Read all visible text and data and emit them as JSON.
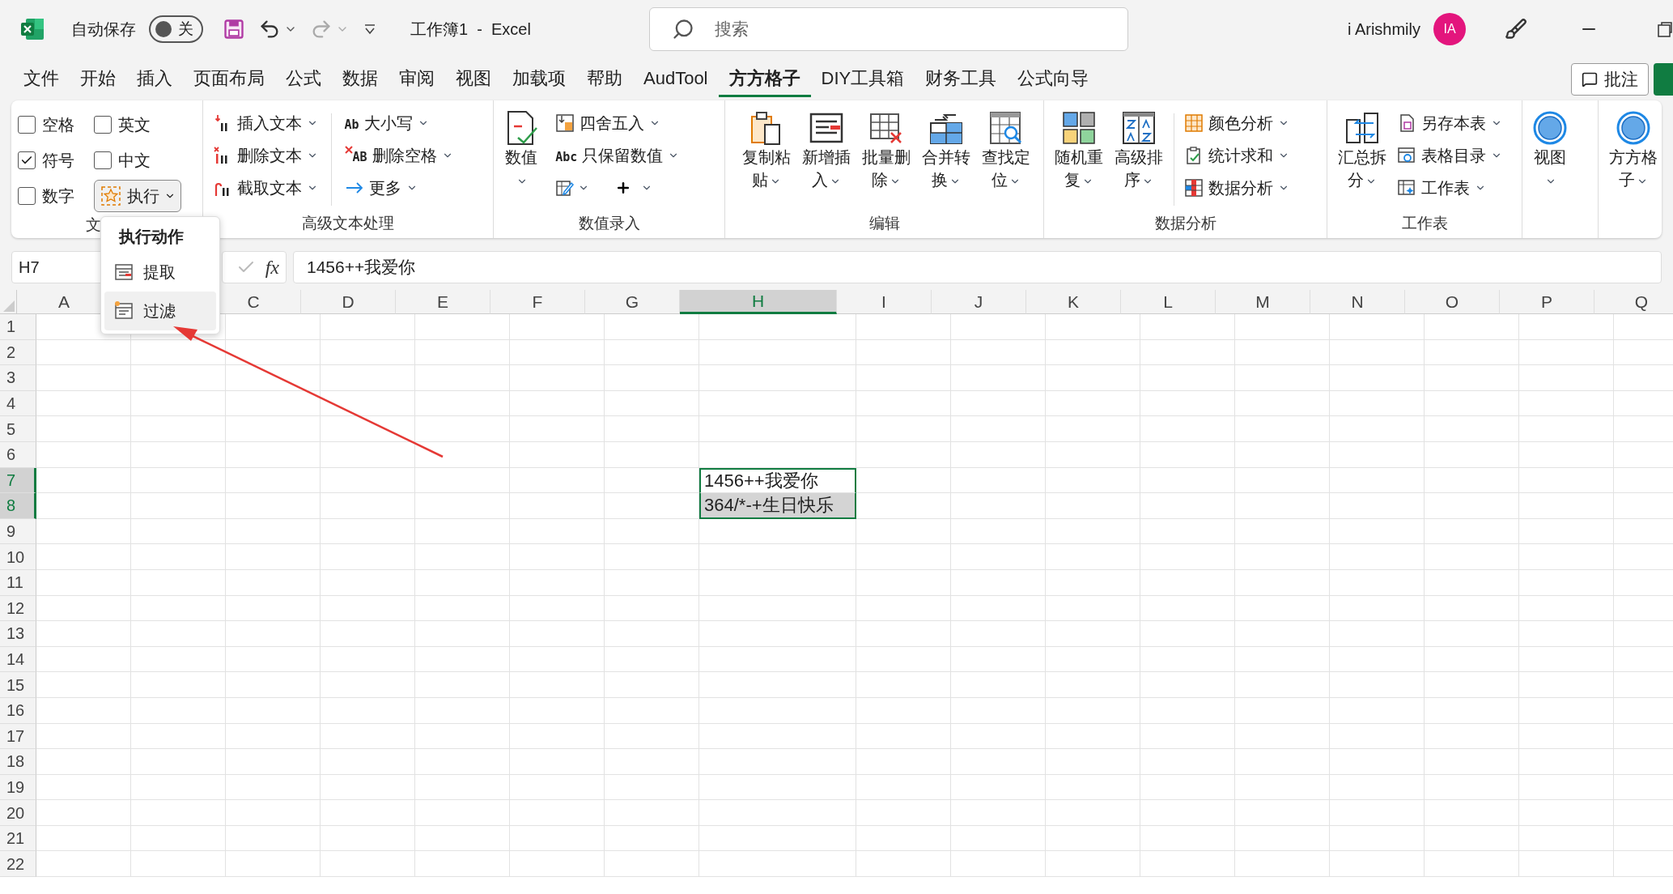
{
  "title_bar": {
    "autosave_label": "自动保存",
    "autosave_on": false,
    "autosave_state": "关",
    "document_title": "工作簿1  -  Excel",
    "search_placeholder": "搜索",
    "user_name": "i Arishmily",
    "avatar_initials": "IA"
  },
  "menu_tabs": [
    {
      "label": "文件",
      "selected": false
    },
    {
      "label": "开始",
      "selected": false
    },
    {
      "label": "插入",
      "selected": false
    },
    {
      "label": "页面布局",
      "selected": false
    },
    {
      "label": "公式",
      "selected": false
    },
    {
      "label": "数据",
      "selected": false
    },
    {
      "label": "审阅",
      "selected": false
    },
    {
      "label": "视图",
      "selected": false
    },
    {
      "label": "加载项",
      "selected": false
    },
    {
      "label": "帮助",
      "selected": false
    },
    {
      "label": "AudTool",
      "selected": false
    },
    {
      "label": "方方格子",
      "selected": true
    },
    {
      "label": "DIY工具箱",
      "selected": false
    },
    {
      "label": "财务工具",
      "selected": false
    },
    {
      "label": "公式向导",
      "selected": false
    }
  ],
  "comment_button": "批注",
  "ribbon": {
    "text_group": {
      "label": "文",
      "checkboxes": [
        {
          "label": "空格",
          "checked": false
        },
        {
          "label": "英文",
          "checked": false
        },
        {
          "label": "符号",
          "checked": true
        },
        {
          "label": "中文",
          "checked": false
        },
        {
          "label": "数字",
          "checked": false
        }
      ],
      "execute_button": {
        "label": "执行",
        "expanded": true
      }
    },
    "advanced_text": {
      "label": "高级文本处理",
      "items": [
        {
          "label": "插入文本"
        },
        {
          "label": "删除文本"
        },
        {
          "label": "截取文本"
        },
        {
          "label": "大小写",
          "glyph": "Ab"
        },
        {
          "label": "删除空格",
          "glyph": "AB"
        },
        {
          "label": "更多"
        }
      ]
    },
    "number_entry": {
      "label": "数值录入",
      "big": {
        "label": "数值"
      },
      "items": [
        {
          "label": "四舍五入"
        },
        {
          "label": "只保留数值",
          "glyph": "Abc"
        }
      ]
    },
    "edit": {
      "label": "编辑",
      "items": [
        {
          "label": "复制粘贴"
        },
        {
          "label": "新增插入"
        },
        {
          "label": "批量删除"
        },
        {
          "label": "合并转换"
        },
        {
          "label": "查找定位"
        }
      ]
    },
    "data_analysis": {
      "label": "数据分析",
      "big": [
        {
          "label": "随机重复"
        },
        {
          "label": "高级排序"
        }
      ],
      "items": [
        {
          "label": "颜色分析"
        },
        {
          "label": "统计求和"
        },
        {
          "label": "数据分析"
        }
      ]
    },
    "worksheet": {
      "label": "工作表",
      "big": {
        "label": "汇总拆分"
      },
      "items": [
        {
          "label": "另存本表"
        },
        {
          "label": "表格目录"
        },
        {
          "label": "工作表"
        }
      ]
    },
    "view": {
      "label": "视图"
    },
    "fangfang": {
      "label": "方方格子"
    }
  },
  "execute_menu": {
    "title": "执行动作",
    "items": [
      {
        "label": "提取",
        "selected": false
      },
      {
        "label": "过滤",
        "selected": true
      }
    ]
  },
  "formula_bar": {
    "name_box": "H7",
    "fx": "fx",
    "formula": "1456++我爱你"
  },
  "sheet": {
    "columns": [
      {
        "name": "A",
        "selected": false
      },
      {},
      {
        "name": "C",
        "selected": false
      },
      {
        "name": "D",
        "selected": false
      },
      {
        "name": "E",
        "selected": false
      },
      {
        "name": "F",
        "selected": false
      },
      {
        "name": "G",
        "selected": false
      },
      {
        "name": "H",
        "selected": true
      },
      {
        "name": "I",
        "selected": false
      },
      {
        "name": "J",
        "selected": false
      },
      {
        "name": "K",
        "selected": false
      },
      {
        "name": "L",
        "selected": false
      },
      {
        "name": "M",
        "selected": false
      },
      {
        "name": "N",
        "selected": false
      },
      {
        "name": "O",
        "selected": false
      },
      {
        "name": "P",
        "selected": false
      },
      {
        "name": "Q",
        "selected": false
      }
    ],
    "rows": [
      {
        "label": "1",
        "selected": false
      },
      {
        "label": "2",
        "selected": false
      },
      {
        "label": "3",
        "selected": false
      },
      {
        "label": "4",
        "selected": false
      },
      {
        "label": "5",
        "selected": false
      },
      {
        "label": "6",
        "selected": false
      },
      {
        "label": "7",
        "selected": true,
        "cells": [
          {
            "value": "1456++我爱你",
            "active": true
          }
        ]
      },
      {
        "label": "8",
        "selected": true,
        "cells": [
          {
            "value": "364/*-+生日快乐",
            "active": false
          }
        ]
      },
      {
        "label": "9",
        "selected": false
      },
      {
        "label": "10",
        "selected": false
      },
      {
        "label": "11",
        "selected": false
      },
      {
        "label": "12",
        "selected": false
      },
      {
        "label": "13",
        "selected": false
      },
      {
        "label": "14",
        "selected": false
      },
      {
        "label": "15",
        "selected": false
      },
      {
        "label": "16",
        "selected": false
      },
      {
        "label": "17",
        "selected": false
      },
      {
        "label": "18",
        "selected": false
      },
      {
        "label": "19",
        "selected": false
      },
      {
        "label": "20",
        "selected": false
      },
      {
        "label": "21",
        "selected": false
      },
      {
        "label": "22",
        "selected": false
      }
    ]
  }
}
